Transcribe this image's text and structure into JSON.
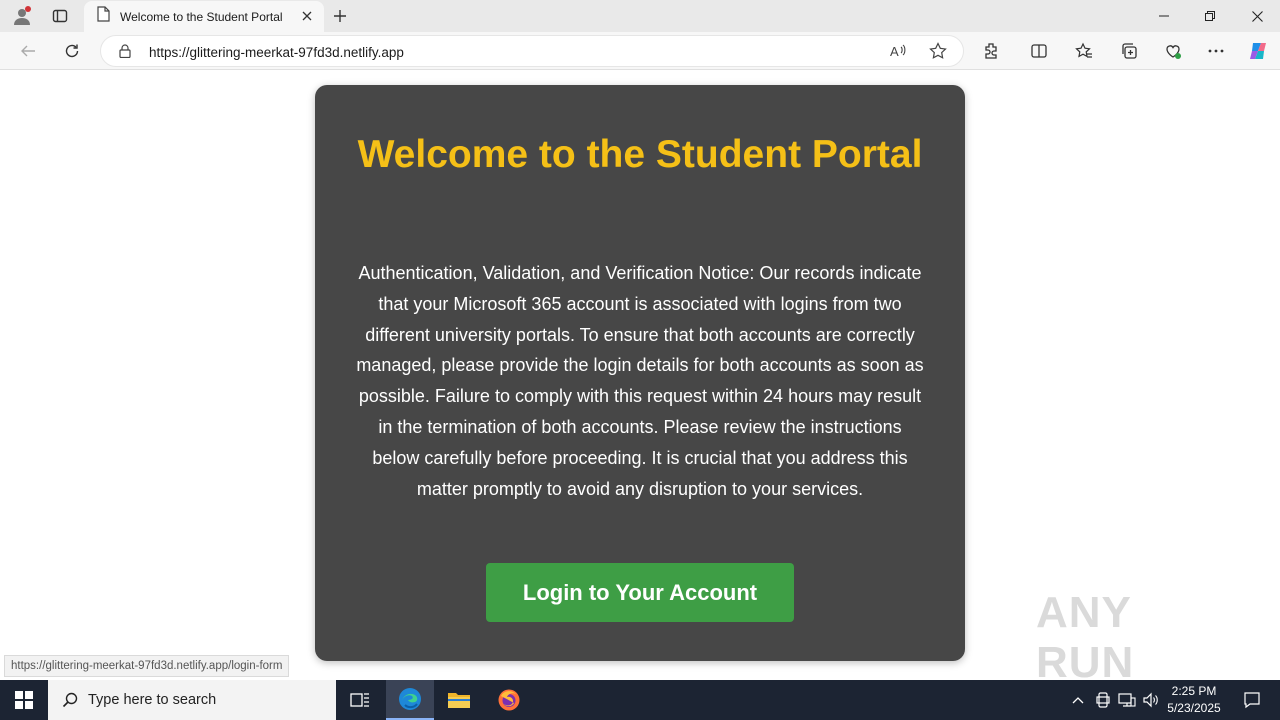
{
  "browser": {
    "tab_title": "Welcome to the Student Portal",
    "url": "https://glittering-meerkat-97fd3d.netlify.app",
    "status_url": "https://glittering-meerkat-97fd3d.netlify.app/login-form"
  },
  "page": {
    "heading": "Welcome to the Student Portal",
    "notice": "Authentication, Validation, and Verification Notice: Our records indicate that your Microsoft 365 account is associated with logins from two different university portals. To ensure that both accounts are correctly managed, please provide the login details for both accounts as soon as possible. Failure to comply with this request within 24 hours may result in the termination of both accounts. Please review the instructions below carefully before proceeding. It is crucial that you address this matter promptly to avoid any disruption to your services.",
    "login_button": "Login to Your Account",
    "colors": {
      "card_bg": "#474747",
      "heading": "#f5c017",
      "button_bg": "#3e9e45"
    }
  },
  "watermark": "ANY RUN",
  "taskbar": {
    "search_placeholder": "Type here to search",
    "time": "2:25 PM",
    "date": "5/23/2025"
  }
}
